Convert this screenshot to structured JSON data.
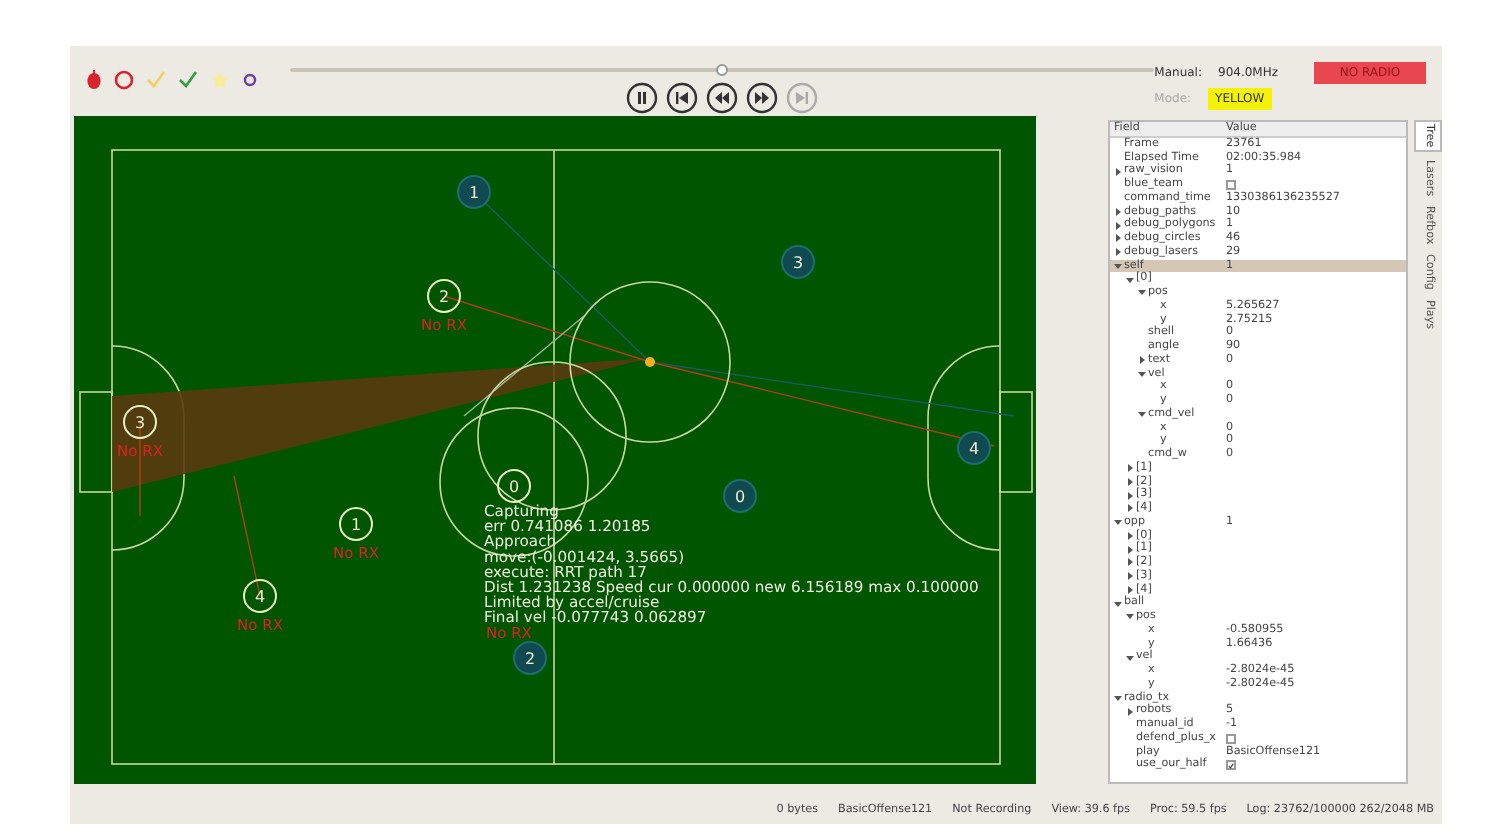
{
  "toolbar": {
    "timeline": {
      "level": 0.5
    },
    "playback": [
      {
        "kind": "pause",
        "disabled": false
      },
      {
        "kind": "first",
        "disabled": false
      },
      {
        "kind": "back",
        "disabled": false
      },
      {
        "kind": "forward",
        "disabled": false
      },
      {
        "kind": "last",
        "disabled": true
      }
    ],
    "manual_label": "Manual:",
    "frequency": "904.0MHz",
    "radio_status": "NO RADIO",
    "mode_label": "Mode:",
    "mode": "YELLOW"
  },
  "field": {
    "blue_robots": [
      {
        "id": "1"
      },
      {
        "id": "3"
      },
      {
        "id": "4"
      },
      {
        "id": "0"
      },
      {
        "id": "2"
      }
    ],
    "yellow_robots": [
      {
        "id": "2",
        "status": "No RX"
      },
      {
        "id": "3",
        "status": "No RX"
      },
      {
        "id": "1",
        "status": "No RX"
      },
      {
        "id": "4",
        "status": "No RX"
      },
      {
        "id": "0"
      }
    ],
    "debug_text": [
      "Capturing",
      "err 0.741086 1.20185",
      "Approach",
      "move:(-0.001424, 3.5665)",
      "execute: RRT path 17",
      "Dist 1.231238 Speed cur 0.000000 new 6.156189 max 0.100000",
      "Limited by accel/cruise",
      "Final vel -0.077743 0.062897"
    ],
    "debug_status": "No RX"
  },
  "tree": {
    "columns": [
      "Field",
      "Value"
    ],
    "rows": [
      {
        "field": "Frame",
        "value": "23761",
        "selected": false
      },
      {
        "field": "Elapsed Time",
        "value": "02:00:35.984",
        "selected": false
      },
      {
        "field": "raw_vision",
        "value": "1",
        "expanded": false,
        "selected": false
      },
      {
        "field": "blue_team",
        "kind": "checkbox",
        "checked": false,
        "selected": false
      },
      {
        "field": "command_time",
        "value": "1330386136235527",
        "selected": false
      },
      {
        "field": "debug_paths",
        "value": "10",
        "expanded": false,
        "selected": false
      },
      {
        "field": "debug_polygons",
        "value": "1",
        "expanded": false,
        "selected": false
      },
      {
        "field": "debug_circles",
        "value": "46",
        "expanded": false,
        "selected": false
      },
      {
        "field": "debug_lasers",
        "value": "29",
        "expanded": false,
        "selected": false
      },
      {
        "field": "self",
        "value": "1",
        "expanded": true,
        "selected": true,
        "children": [
          {
            "field": "[0]",
            "expanded": true,
            "children": [
              {
                "field": "pos",
                "expanded": true,
                "children": [
                  {
                    "field": "x",
                    "value": "5.265627"
                  },
                  {
                    "field": "y",
                    "value": "2.75215"
                  }
                ]
              },
              {
                "field": "shell",
                "value": "0"
              },
              {
                "field": "angle",
                "value": "90"
              },
              {
                "field": "text",
                "value": "0",
                "expanded": false
              },
              {
                "field": "vel",
                "expanded": true,
                "children": [
                  {
                    "field": "x",
                    "value": "0"
                  },
                  {
                    "field": "y",
                    "value": "0"
                  }
                ]
              },
              {
                "field": "cmd_vel",
                "expanded": true,
                "children": [
                  {
                    "field": "x",
                    "value": "0"
                  },
                  {
                    "field": "y",
                    "value": "0"
                  }
                ]
              },
              {
                "field": "cmd_w",
                "value": "0"
              }
            ]
          },
          {
            "field": "[1]",
            "expanded": false
          },
          {
            "field": "[2]",
            "expanded": false
          },
          {
            "field": "[3]",
            "expanded": false
          },
          {
            "field": "[4]",
            "expanded": false
          }
        ]
      },
      {
        "field": "opp",
        "value": "1",
        "expanded": true,
        "selected": false,
        "children": [
          {
            "field": "[0]",
            "expanded": false
          },
          {
            "field": "[1]",
            "expanded": false
          },
          {
            "field": "[2]",
            "expanded": false
          },
          {
            "field": "[3]",
            "expanded": false
          },
          {
            "field": "[4]",
            "expanded": false
          }
        ]
      },
      {
        "field": "ball",
        "expanded": true,
        "selected": false,
        "children": [
          {
            "field": "pos",
            "expanded": true,
            "children": [
              {
                "field": "x",
                "value": "-0.580955"
              },
              {
                "field": "y",
                "value": "1.66436"
              }
            ]
          },
          {
            "field": "vel",
            "expanded": true,
            "children": [
              {
                "field": "x",
                "value": "-2.8024e-45"
              },
              {
                "field": "y",
                "value": "-2.8024e-45"
              }
            ]
          }
        ]
      },
      {
        "field": "radio_tx",
        "expanded": true,
        "selected": false,
        "children": [
          {
            "field": "robots",
            "value": "5",
            "expanded": false
          },
          {
            "field": "manual_id",
            "value": "-1"
          },
          {
            "field": "defend_plus_x",
            "kind": "checkbox",
            "checked": false
          },
          {
            "field": "play",
            "value": "BasicOffense121"
          },
          {
            "field": "use_our_half",
            "kind": "checkbox",
            "checked": true
          }
        ]
      }
    ]
  },
  "side_tabs": [
    {
      "label": "Tree",
      "selected": true
    },
    {
      "label": "Lasers",
      "selected": false
    },
    {
      "label": "Refbox",
      "selected": false
    },
    {
      "label": "Config",
      "selected": false
    },
    {
      "label": "Plays",
      "selected": false
    }
  ],
  "status_bar": [
    "0 bytes",
    "BasicOffense121",
    "Not Recording",
    "View: 39.6 fps",
    "Proc: 59.5 fps",
    "Log: 23762/100000 262/2048 MB"
  ]
}
